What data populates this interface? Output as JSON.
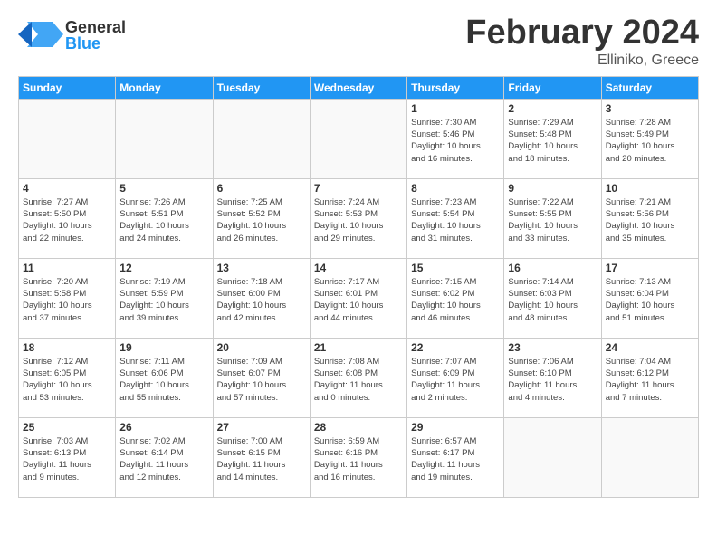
{
  "header": {
    "logo_general": "General",
    "logo_blue": "Blue",
    "month_year": "February 2024",
    "location": "Elliniko, Greece"
  },
  "days_of_week": [
    "Sunday",
    "Monday",
    "Tuesday",
    "Wednesday",
    "Thursday",
    "Friday",
    "Saturday"
  ],
  "weeks": [
    [
      {
        "day": "",
        "info": ""
      },
      {
        "day": "",
        "info": ""
      },
      {
        "day": "",
        "info": ""
      },
      {
        "day": "",
        "info": ""
      },
      {
        "day": "1",
        "info": "Sunrise: 7:30 AM\nSunset: 5:46 PM\nDaylight: 10 hours\nand 16 minutes."
      },
      {
        "day": "2",
        "info": "Sunrise: 7:29 AM\nSunset: 5:48 PM\nDaylight: 10 hours\nand 18 minutes."
      },
      {
        "day": "3",
        "info": "Sunrise: 7:28 AM\nSunset: 5:49 PM\nDaylight: 10 hours\nand 20 minutes."
      }
    ],
    [
      {
        "day": "4",
        "info": "Sunrise: 7:27 AM\nSunset: 5:50 PM\nDaylight: 10 hours\nand 22 minutes."
      },
      {
        "day": "5",
        "info": "Sunrise: 7:26 AM\nSunset: 5:51 PM\nDaylight: 10 hours\nand 24 minutes."
      },
      {
        "day": "6",
        "info": "Sunrise: 7:25 AM\nSunset: 5:52 PM\nDaylight: 10 hours\nand 26 minutes."
      },
      {
        "day": "7",
        "info": "Sunrise: 7:24 AM\nSunset: 5:53 PM\nDaylight: 10 hours\nand 29 minutes."
      },
      {
        "day": "8",
        "info": "Sunrise: 7:23 AM\nSunset: 5:54 PM\nDaylight: 10 hours\nand 31 minutes."
      },
      {
        "day": "9",
        "info": "Sunrise: 7:22 AM\nSunset: 5:55 PM\nDaylight: 10 hours\nand 33 minutes."
      },
      {
        "day": "10",
        "info": "Sunrise: 7:21 AM\nSunset: 5:56 PM\nDaylight: 10 hours\nand 35 minutes."
      }
    ],
    [
      {
        "day": "11",
        "info": "Sunrise: 7:20 AM\nSunset: 5:58 PM\nDaylight: 10 hours\nand 37 minutes."
      },
      {
        "day": "12",
        "info": "Sunrise: 7:19 AM\nSunset: 5:59 PM\nDaylight: 10 hours\nand 39 minutes."
      },
      {
        "day": "13",
        "info": "Sunrise: 7:18 AM\nSunset: 6:00 PM\nDaylight: 10 hours\nand 42 minutes."
      },
      {
        "day": "14",
        "info": "Sunrise: 7:17 AM\nSunset: 6:01 PM\nDaylight: 10 hours\nand 44 minutes."
      },
      {
        "day": "15",
        "info": "Sunrise: 7:15 AM\nSunset: 6:02 PM\nDaylight: 10 hours\nand 46 minutes."
      },
      {
        "day": "16",
        "info": "Sunrise: 7:14 AM\nSunset: 6:03 PM\nDaylight: 10 hours\nand 48 minutes."
      },
      {
        "day": "17",
        "info": "Sunrise: 7:13 AM\nSunset: 6:04 PM\nDaylight: 10 hours\nand 51 minutes."
      }
    ],
    [
      {
        "day": "18",
        "info": "Sunrise: 7:12 AM\nSunset: 6:05 PM\nDaylight: 10 hours\nand 53 minutes."
      },
      {
        "day": "19",
        "info": "Sunrise: 7:11 AM\nSunset: 6:06 PM\nDaylight: 10 hours\nand 55 minutes."
      },
      {
        "day": "20",
        "info": "Sunrise: 7:09 AM\nSunset: 6:07 PM\nDaylight: 10 hours\nand 57 minutes."
      },
      {
        "day": "21",
        "info": "Sunrise: 7:08 AM\nSunset: 6:08 PM\nDaylight: 11 hours\nand 0 minutes."
      },
      {
        "day": "22",
        "info": "Sunrise: 7:07 AM\nSunset: 6:09 PM\nDaylight: 11 hours\nand 2 minutes."
      },
      {
        "day": "23",
        "info": "Sunrise: 7:06 AM\nSunset: 6:10 PM\nDaylight: 11 hours\nand 4 minutes."
      },
      {
        "day": "24",
        "info": "Sunrise: 7:04 AM\nSunset: 6:12 PM\nDaylight: 11 hours\nand 7 minutes."
      }
    ],
    [
      {
        "day": "25",
        "info": "Sunrise: 7:03 AM\nSunset: 6:13 PM\nDaylight: 11 hours\nand 9 minutes."
      },
      {
        "day": "26",
        "info": "Sunrise: 7:02 AM\nSunset: 6:14 PM\nDaylight: 11 hours\nand 12 minutes."
      },
      {
        "day": "27",
        "info": "Sunrise: 7:00 AM\nSunset: 6:15 PM\nDaylight: 11 hours\nand 14 minutes."
      },
      {
        "day": "28",
        "info": "Sunrise: 6:59 AM\nSunset: 6:16 PM\nDaylight: 11 hours\nand 16 minutes."
      },
      {
        "day": "29",
        "info": "Sunrise: 6:57 AM\nSunset: 6:17 PM\nDaylight: 11 hours\nand 19 minutes."
      },
      {
        "day": "",
        "info": ""
      },
      {
        "day": "",
        "info": ""
      }
    ]
  ]
}
